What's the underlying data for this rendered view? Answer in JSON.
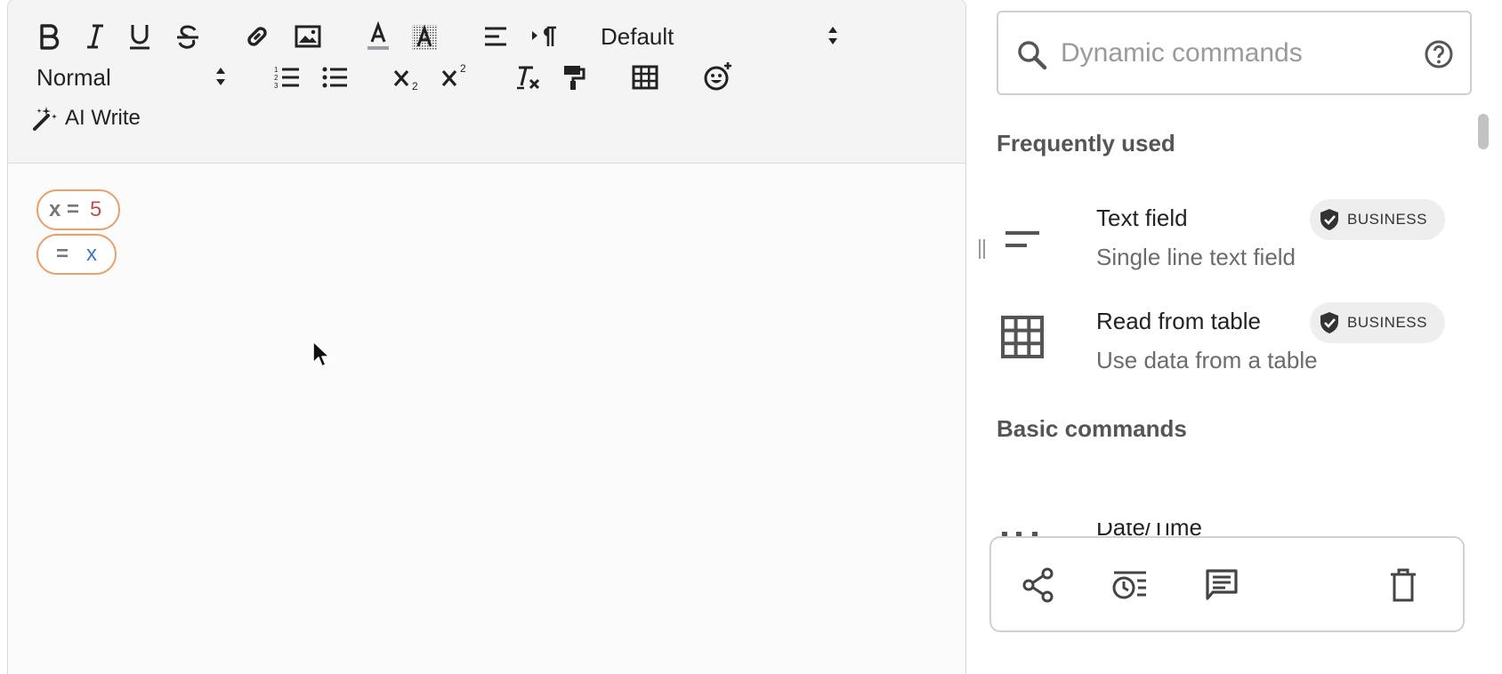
{
  "toolbar": {
    "font_family_value": "Default",
    "paragraph_style_value": "Normal",
    "ai_write_label": "AI Write"
  },
  "editor": {
    "chips": [
      {
        "label": "x =",
        "value": "5",
        "value_color": "#c0504d"
      },
      {
        "label": "=",
        "value": "x",
        "value_color": "#3b73c8"
      }
    ]
  },
  "panel": {
    "search_placeholder": "Dynamic commands",
    "sections": [
      {
        "title": "Frequently used",
        "items": [
          {
            "title": "Text field",
            "description": "Single line text field",
            "badge": "BUSINESS",
            "icon": "short-text-icon"
          },
          {
            "title": "Read from table",
            "description": "Use data from a table",
            "badge": "BUSINESS",
            "icon": "grid-table-icon"
          }
        ]
      },
      {
        "title": "Basic commands",
        "items": [
          {
            "title": "Date/Time",
            "icon": "date-time-icon"
          }
        ]
      }
    ],
    "actions": [
      "share-icon",
      "history-icon",
      "comment-icon",
      "delete-icon"
    ]
  },
  "colors": {
    "accent_border": "#e9a06a",
    "badge_bg": "#eeeeee"
  }
}
